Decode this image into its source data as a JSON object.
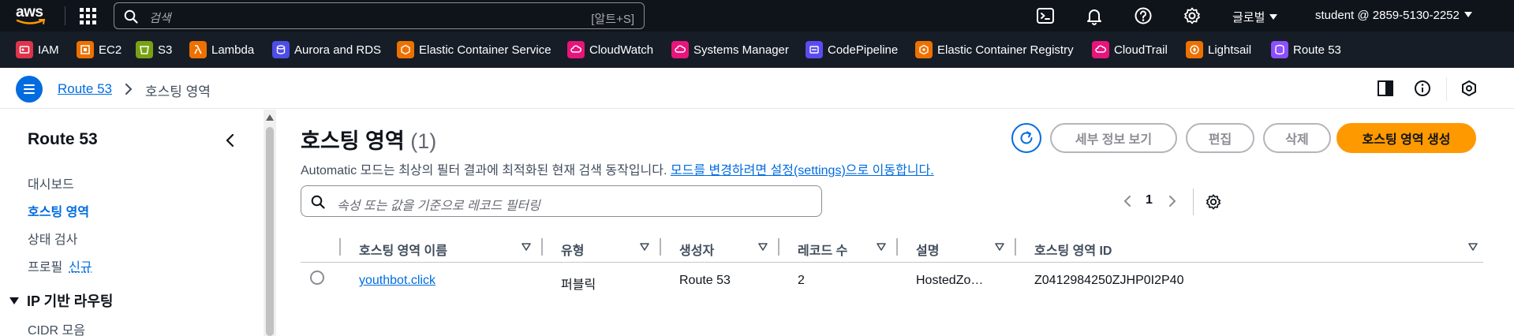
{
  "topnav": {
    "logo_text": "aws",
    "search_placeholder": "검색",
    "search_shortcut": "[알트+S]",
    "region_label": "글로벌",
    "account_label": "student @ 2859-5130-2252"
  },
  "favorites": [
    {
      "label": "IAM",
      "color": "#dd344c",
      "icon": "iam-icon"
    },
    {
      "label": "EC2",
      "color": "#ed7100",
      "icon": "ec2-icon"
    },
    {
      "label": "S3",
      "color": "#7aa116",
      "icon": "s3-icon"
    },
    {
      "label": "Lambda",
      "color": "#ed7100",
      "icon": "lambda-icon"
    },
    {
      "label": "Aurora and RDS",
      "color": "#4d4de8",
      "icon": "rds-icon"
    },
    {
      "label": "Elastic Container Service",
      "color": "#ed7100",
      "icon": "ecs-icon"
    },
    {
      "label": "CloudWatch",
      "color": "#e7157b",
      "icon": "cloudwatch-icon"
    },
    {
      "label": "Systems Manager",
      "color": "#e7157b",
      "icon": "systems-manager-icon"
    },
    {
      "label": "CodePipeline",
      "color": "#5a4cf2",
      "icon": "codepipeline-icon"
    },
    {
      "label": "Elastic Container Registry",
      "color": "#ed7100",
      "icon": "ecr-icon"
    },
    {
      "label": "CloudTrail",
      "color": "#e7157b",
      "icon": "cloudtrail-icon"
    },
    {
      "label": "Lightsail",
      "color": "#ed7100",
      "icon": "lightsail-icon"
    },
    {
      "label": "Route 53",
      "color": "#8c4fff",
      "icon": "route53-icon"
    }
  ],
  "breadcrumb": {
    "parent": "Route 53",
    "current": "호스팅 영역"
  },
  "sidebar": {
    "title": "Route 53",
    "items": [
      {
        "label": "대시보드"
      },
      {
        "label": "호스팅 영역"
      },
      {
        "label": "상태 검사"
      },
      {
        "label": "프로필",
        "badge": "신규"
      }
    ],
    "section": "IP 기반 라우팅",
    "sub_item": "CIDR 모음"
  },
  "main": {
    "title": "호스팅 영역",
    "count": "(1)",
    "description": "Automatic 모드는 최상의 필터 결과에 최적화된 현재 검색 동작입니다.",
    "description_link": "모드를 변경하려면 설정(settings)으로 이동합니다.",
    "buttons": {
      "details": "세부 정보 보기",
      "edit": "편집",
      "delete": "삭제",
      "create": "호스팅 영역 생성"
    },
    "filter_placeholder": "속성 또는 값을 기준으로 레코드 필터링",
    "page_number": "1"
  },
  "table": {
    "columns": [
      "호스팅 영역 이름",
      "유형",
      "생성자",
      "레코드 수",
      "설명",
      "호스팅 영역 ID"
    ],
    "rows": [
      {
        "name": "youthbot.click",
        "type": "퍼블릭",
        "created_by": "Route 53",
        "record_count": "2",
        "description": "HostedZo…",
        "id": "Z0412984250ZJHP0I2P40"
      }
    ]
  },
  "colors": {
    "topbar_bg": "#0f141a",
    "link_blue": "#006ce0",
    "primary_orange": "#ff9900"
  }
}
